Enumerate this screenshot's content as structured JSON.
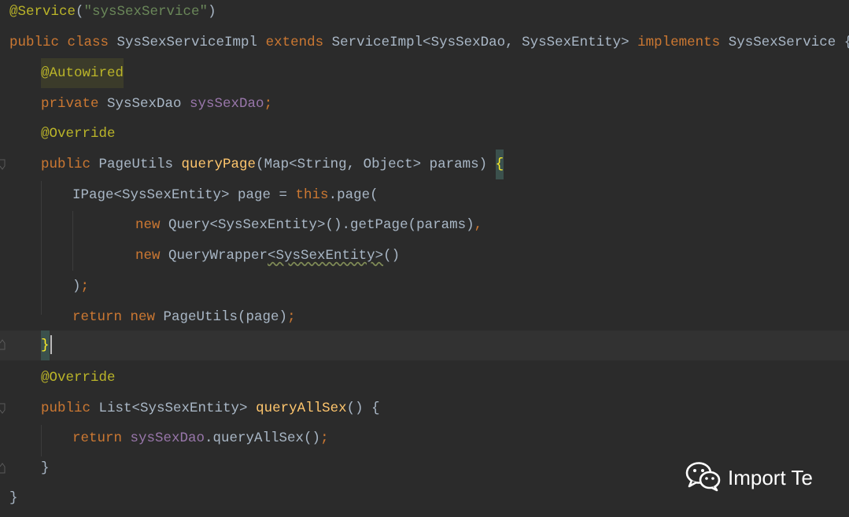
{
  "editor": {
    "lines": [
      [
        {
          "t": "@Service",
          "c": "ann"
        },
        {
          "t": "(",
          "c": "plain"
        },
        {
          "t": "\"sysSexService\"",
          "c": "str"
        },
        {
          "t": ")",
          "c": "plain"
        }
      ],
      [
        {
          "t": "public class ",
          "c": "kw"
        },
        {
          "t": "SysSexServiceImpl ",
          "c": "plain"
        },
        {
          "t": "extends ",
          "c": "kw"
        },
        {
          "t": "ServiceImpl<SysSexDao, SysSexEntity> ",
          "c": "plain"
        },
        {
          "t": "implements ",
          "c": "kw"
        },
        {
          "t": "SysSexService {",
          "c": "plain"
        }
      ],
      [
        {
          "t": "@Autowired",
          "c": "ann hl-ann"
        }
      ],
      [
        {
          "t": "private ",
          "c": "kw"
        },
        {
          "t": "SysSexDao ",
          "c": "plain"
        },
        {
          "t": "sysSexDao",
          "c": "fld"
        },
        {
          "t": ";",
          "c": "kw"
        }
      ],
      [
        {
          "t": "@Override",
          "c": "ann"
        }
      ],
      [
        {
          "t": "public ",
          "c": "kw"
        },
        {
          "t": "PageUtils ",
          "c": "plain"
        },
        {
          "t": "queryPage",
          "c": "meth"
        },
        {
          "t": "(Map<String, Object> params) ",
          "c": "plain"
        },
        {
          "t": "{",
          "c": "brace-hl"
        }
      ],
      [
        {
          "t": "IPage<SysSexEntity> page = ",
          "c": "plain"
        },
        {
          "t": "this",
          "c": "kw"
        },
        {
          "t": ".page(",
          "c": "plain"
        }
      ],
      [
        {
          "t": "new ",
          "c": "kw"
        },
        {
          "t": "Query<SysSexEntity>().getPage(params)",
          "c": "plain"
        },
        {
          "t": ",",
          "c": "kw"
        }
      ],
      [
        {
          "t": "new ",
          "c": "kw"
        },
        {
          "t": "QueryWrapper",
          "c": "plain"
        },
        {
          "t": "<SysSexEntity>",
          "c": "plain warn"
        },
        {
          "t": "()",
          "c": "plain"
        }
      ],
      [
        {
          "t": ")",
          "c": "plain"
        },
        {
          "t": ";",
          "c": "kw"
        }
      ],
      [
        {
          "t": "return new ",
          "c": "kw"
        },
        {
          "t": "PageUtils(page)",
          "c": "plain"
        },
        {
          "t": ";",
          "c": "kw"
        }
      ],
      [
        {
          "t": "}",
          "c": "brace-hl"
        }
      ],
      [
        {
          "t": "@Override",
          "c": "ann"
        }
      ],
      [
        {
          "t": "public ",
          "c": "kw"
        },
        {
          "t": "List<SysSexEntity> ",
          "c": "plain"
        },
        {
          "t": "queryAllSex",
          "c": "meth"
        },
        {
          "t": "() {",
          "c": "plain"
        }
      ],
      [
        {
          "t": "return ",
          "c": "kw"
        },
        {
          "t": "sysSexDao",
          "c": "fld"
        },
        {
          "t": ".queryAllSex()",
          "c": "plain"
        },
        {
          "t": ";",
          "c": "kw"
        }
      ],
      [
        {
          "t": "}",
          "c": "plain"
        }
      ],
      [
        {
          "t": "}",
          "c": "plain"
        }
      ]
    ]
  },
  "watermark": {
    "text": "Import Te",
    "icon": "wechat-icon"
  }
}
